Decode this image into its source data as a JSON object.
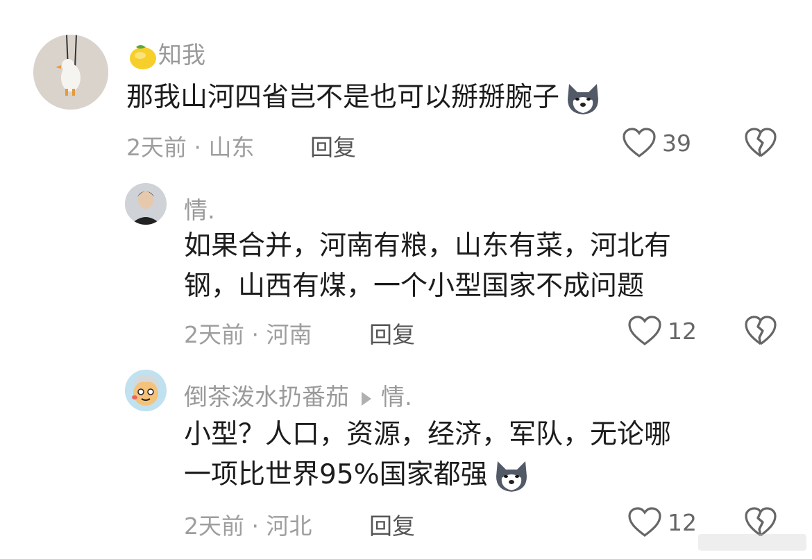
{
  "comments": [
    {
      "user": "知我",
      "name_prefix_icon": "lemon-icon",
      "text_lines": [
        "那我山河四省岂不是也可以掰掰腕子"
      ],
      "trailing_emoji": "husky-emoji",
      "time": "2天前",
      "location": "山东",
      "reply_label": "回复",
      "likes": "39"
    },
    {
      "user": "情.",
      "text_lines": [
        "如果合并，河南有粮，山东有菜，河北有",
        "钢，山西有煤，一个小型国家不成问题"
      ],
      "time": "2天前",
      "location": "河南",
      "reply_label": "回复",
      "likes": "12"
    },
    {
      "user": "倒茶泼水扔番茄",
      "reply_to": "情.",
      "text_lines": [
        "小型？人口，资源，经济，军队，无论哪",
        "一项比世界95%国家都强"
      ],
      "trailing_emoji": "husky-emoji",
      "time": "2天前",
      "location": "河北",
      "reply_label": "回复",
      "likes": "12"
    }
  ],
  "meta_separator": " · "
}
